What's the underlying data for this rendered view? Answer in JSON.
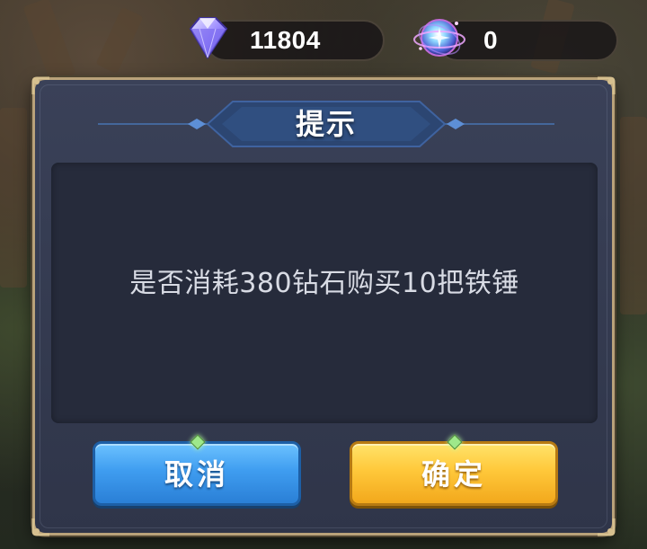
{
  "currency": {
    "diamond": {
      "icon": "diamond-icon",
      "value": "11804"
    },
    "orb": {
      "icon": "crystal-orb-icon",
      "value": "0"
    }
  },
  "dialog": {
    "title": "提示",
    "message": "是否消耗380钻石购买10把铁锤",
    "cancel_label": "取消",
    "confirm_label": "确定"
  },
  "colors": {
    "dialog_bg": "#343b52",
    "dialog_border": "#b9a27a",
    "cancel_button": "#3f9df0",
    "confirm_button": "#ffc83a"
  }
}
